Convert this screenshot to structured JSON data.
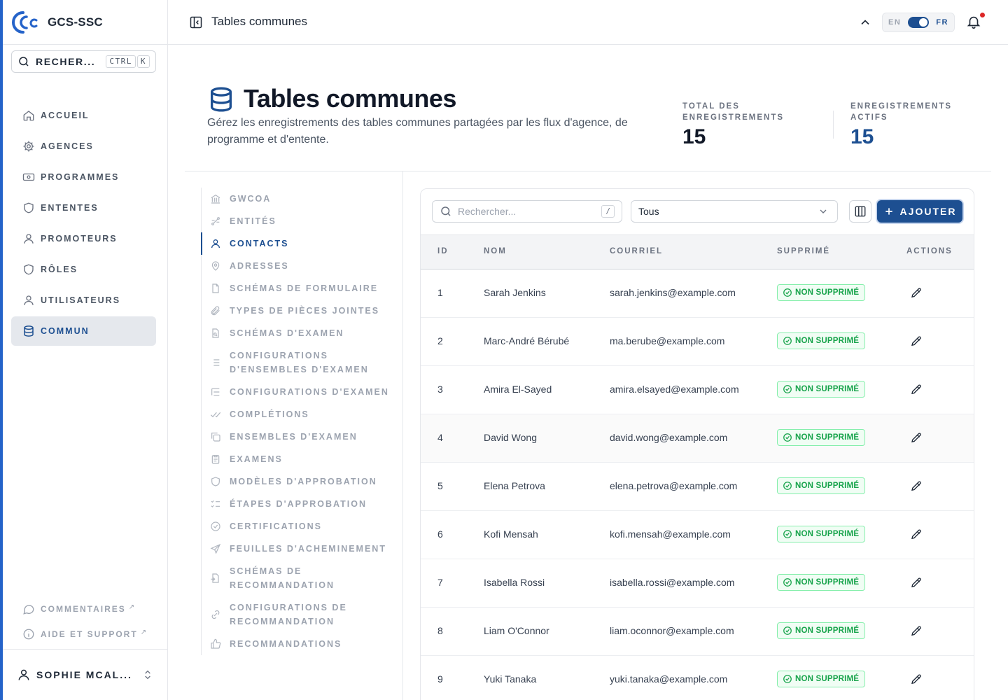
{
  "app": {
    "brand": "GCS-SSC"
  },
  "sidebar": {
    "search_label": "RECHER...",
    "shortcut_keys": [
      "CTRL",
      "K"
    ],
    "items": [
      {
        "label": "ACCUEIL",
        "icon": "home-icon"
      },
      {
        "label": "AGENCES",
        "icon": "gear-icon"
      },
      {
        "label": "PROGRAMMES",
        "icon": "banknote-icon"
      },
      {
        "label": "ENTENTES",
        "icon": "shield-icon"
      },
      {
        "label": "PROMOTEURS",
        "icon": "user-icon"
      },
      {
        "label": "RÔLES",
        "icon": "shield-icon"
      },
      {
        "label": "UTILISATEURS",
        "icon": "user-icon"
      },
      {
        "label": "COMMUN",
        "icon": "database-icon",
        "active": true
      }
    ],
    "footer_links": [
      {
        "label": "COMMENTAIRES",
        "icon": "message-icon"
      },
      {
        "label": "AIDE ET SUPPORT",
        "icon": "info-icon"
      }
    ],
    "user_name": "SOPHIE MCAL..."
  },
  "topbar": {
    "title": "Tables communes",
    "lang_en": "EN",
    "lang_fr": "FR",
    "active_lang": "FR"
  },
  "header": {
    "title": "Tables communes",
    "description": "Gérez les enregistrements des tables communes partagées par les flux d'agence, de programme et d'entente.",
    "stats": [
      {
        "label": "TOTAL DES ENREGISTREMENTS",
        "value": "15"
      },
      {
        "label": "ENREGISTREMENTS ACTIFS",
        "value": "15"
      }
    ]
  },
  "subnav": {
    "items": [
      {
        "label": "GWCOA",
        "icon": "bank-icon"
      },
      {
        "label": "ENTITÉS",
        "icon": "network-icon"
      },
      {
        "label": "CONTACTS",
        "icon": "user-icon",
        "active": true
      },
      {
        "label": "ADRESSES",
        "icon": "map-pin-icon"
      },
      {
        "label": "SCHÉMAS DE FORMULAIRE",
        "icon": "file-icon"
      },
      {
        "label": "TYPES DE PIÈCES JOINTES",
        "icon": "paperclip-icon"
      },
      {
        "label": "SCHÉMAS D'EXAMEN",
        "icon": "file-search-icon"
      },
      {
        "label": "CONFIGURATIONS D'ENSEMBLES D'EXAMEN",
        "icon": "list-icon"
      },
      {
        "label": "CONFIGURATIONS D'EXAMEN",
        "icon": "list-tree-icon"
      },
      {
        "label": "COMPLÉTIONS",
        "icon": "double-check-icon"
      },
      {
        "label": "ENSEMBLES D'EXAMEN",
        "icon": "copy-icon"
      },
      {
        "label": "EXAMENS",
        "icon": "clipboard-icon"
      },
      {
        "label": "MODÈLES D'APPROBATION",
        "icon": "shield-icon"
      },
      {
        "label": "ÉTAPES D'APPROBATION",
        "icon": "list-checks-icon"
      },
      {
        "label": "CERTIFICATIONS",
        "icon": "badge-check-icon"
      },
      {
        "label": "FEUILLES D'ACHEMINEMENT",
        "icon": "send-icon"
      },
      {
        "label": "SCHÉMAS DE RECOMMANDATION",
        "icon": "file-input-icon"
      },
      {
        "label": "CONFIGURATIONS DE RECOMMANDATION",
        "icon": "settings-link-icon"
      },
      {
        "label": "RECOMMANDATIONS",
        "icon": "thumbs-up-icon"
      }
    ]
  },
  "table": {
    "search_placeholder": "Rechercher...",
    "search_shortcut": "/",
    "filter_value": "Tous",
    "add_label": "AJOUTER",
    "columns": [
      "ID",
      "NOM",
      "COURRIEL",
      "SUPPRIMÉ",
      "ACTIONS"
    ],
    "rows": [
      {
        "id": "1",
        "name": "Sarah Jenkins",
        "email": "sarah.jenkins@example.com",
        "status": "NON SUPPRIMÉ"
      },
      {
        "id": "2",
        "name": "Marc-André Bérubé",
        "email": "ma.berube@example.com",
        "status": "NON SUPPRIMÉ"
      },
      {
        "id": "3",
        "name": "Amira El-Sayed",
        "email": "amira.elsayed@example.com",
        "status": "NON SUPPRIMÉ"
      },
      {
        "id": "4",
        "name": "David Wong",
        "email": "david.wong@example.com",
        "status": "NON SUPPRIMÉ"
      },
      {
        "id": "5",
        "name": "Elena Petrova",
        "email": "elena.petrova@example.com",
        "status": "NON SUPPRIMÉ"
      },
      {
        "id": "6",
        "name": "Kofi Mensah",
        "email": "kofi.mensah@example.com",
        "status": "NON SUPPRIMÉ"
      },
      {
        "id": "7",
        "name": "Isabella Rossi",
        "email": "isabella.rossi@example.com",
        "status": "NON SUPPRIMÉ"
      },
      {
        "id": "8",
        "name": "Liam O'Connor",
        "email": "liam.oconnor@example.com",
        "status": "NON SUPPRIMÉ"
      },
      {
        "id": "9",
        "name": "Yuki Tanaka",
        "email": "yuki.tanaka@example.com",
        "status": "NON SUPPRIMÉ"
      }
    ]
  },
  "colors": {
    "primary": "#1d4f91",
    "accent_bar": "#2563c9",
    "success": "#16a34a",
    "notification": "#dc2626"
  }
}
